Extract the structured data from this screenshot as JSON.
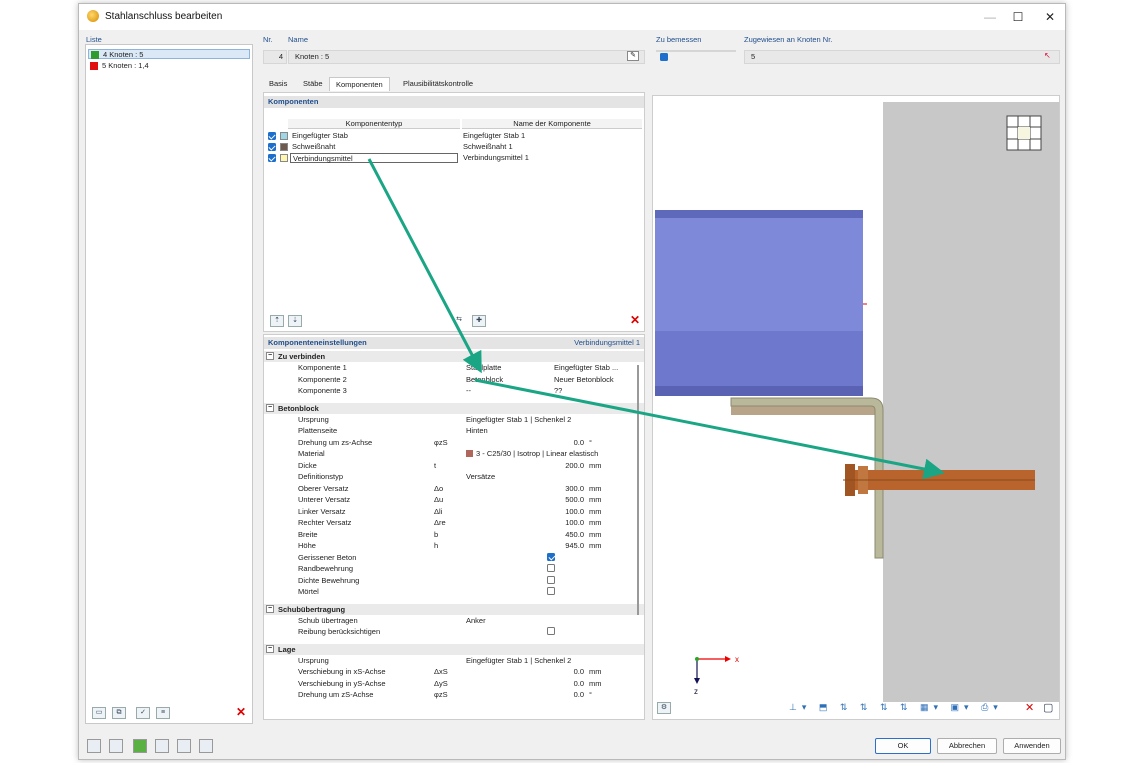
{
  "window": {
    "title": "Stahlanschluss bearbeiten"
  },
  "list": {
    "label": "Liste",
    "items": [
      {
        "label": "4 Knoten : 5",
        "color": "#2e9b2e",
        "selected": true
      },
      {
        "label": "5 Knoten : 1,4",
        "color": "#e01010",
        "selected": false
      }
    ]
  },
  "header": {
    "nr_label": "Nr.",
    "nr_value": "4",
    "name_label": "Name",
    "name_value": "Knoten : 5",
    "zu_bemessen_label": "Zu bemessen",
    "zugewiesen_label": "Zugewiesen an Knoten Nr.",
    "zugewiesen_value": "5"
  },
  "tabs": [
    {
      "label": "Basis"
    },
    {
      "label": "Stäbe"
    },
    {
      "label": "Komponenten",
      "active": true
    },
    {
      "label": "Plausibilitätskontrolle"
    }
  ],
  "components": {
    "title": "Komponenten",
    "col_type": "Komponententyp",
    "col_name": "Name der Komponente",
    "rows": [
      {
        "type": "Eingefügter Stab",
        "name": "Eingefügter Stab 1",
        "color": "#9fd6e6"
      },
      {
        "type": "Schweißnaht",
        "name": "Schweißnaht 1",
        "color": "#6e5a4e"
      },
      {
        "type": "Verbindungsmittel",
        "name": "Verbindungsmittel 1",
        "color": "#fff6b0"
      }
    ]
  },
  "settings": {
    "title": "Komponenteneinstellungen",
    "current": "Verbindungsmittel 1",
    "groups": [
      {
        "title": "Zu verbinden",
        "rows": [
          {
            "name": "Komponente 1",
            "v": "Stahlplatte",
            "v2": "Eingefügter Stab ..."
          },
          {
            "name": "Komponente 2",
            "v": "Betonblock",
            "v2": "Neuer Betonblock"
          },
          {
            "name": "Komponente 3",
            "v": "--",
            "v2": "??"
          }
        ]
      },
      {
        "title": "Betonblock",
        "rows": [
          {
            "name": "Ursprung",
            "v": "Eingefügter Stab 1 | Schenkel 2"
          },
          {
            "name": "Plattenseite",
            "v": "Hinten"
          },
          {
            "name": "Drehung um zs-Achse",
            "sym": "φzS",
            "num": "0.0",
            "unit": "°"
          },
          {
            "name": "Material",
            "v": "3 - C25/30 | Isotrop | Linear elastisch",
            "swatch": "#b0665a"
          },
          {
            "name": "Dicke",
            "sym": "t",
            "num": "200.0",
            "unit": "mm"
          },
          {
            "name": "Definitionstyp",
            "v": "Versätze"
          },
          {
            "name": "Oberer Versatz",
            "sym": "Δo",
            "num": "300.0",
            "unit": "mm"
          },
          {
            "name": "Unterer Versatz",
            "sym": "Δu",
            "num": "500.0",
            "unit": "mm"
          },
          {
            "name": "Linker Versatz",
            "sym": "Δli",
            "num": "100.0",
            "unit": "mm"
          },
          {
            "name": "Rechter Versatz",
            "sym": "Δre",
            "num": "100.0",
            "unit": "mm"
          },
          {
            "name": "Breite",
            "sym": "b",
            "num": "450.0",
            "unit": "mm"
          },
          {
            "name": "Höhe",
            "sym": "h",
            "num": "945.0",
            "unit": "mm"
          },
          {
            "name": "Gerissener Beton",
            "check": true
          },
          {
            "name": "Randbewehrung",
            "check": false
          },
          {
            "name": "Dichte Bewehrung",
            "check": false
          },
          {
            "name": "Mörtel",
            "check": false
          }
        ]
      },
      {
        "title": "Schubübertragung",
        "rows": [
          {
            "name": "Schub übertragen",
            "v": "Anker"
          },
          {
            "name": "Reibung berücksichtigen",
            "check": false
          }
        ]
      },
      {
        "title": "Lage",
        "rows": [
          {
            "name": "Ursprung",
            "v": "Eingefügter Stab 1 | Schenkel 2"
          },
          {
            "name": "Verschiebung in xS-Achse",
            "sym": "ΔxS",
            "num": "0.0",
            "unit": "mm"
          },
          {
            "name": "Verschiebung in yS-Achse",
            "sym": "ΔyS",
            "num": "0.0",
            "unit": "mm"
          },
          {
            "name": "Drehung um zS-Achse",
            "sym": "φzS",
            "num": "0.0",
            "unit": "°"
          }
        ]
      }
    ]
  },
  "view": {
    "axis_x": "x",
    "axis_z": "z"
  },
  "buttons": {
    "ok": "OK",
    "cancel": "Abbrechen",
    "apply": "Anwenden"
  },
  "colors": {
    "accent": "#1e6fcc",
    "arrow": "#1aa584",
    "beam": "#7c86d6",
    "angle": "#b9b89a",
    "bolt": "#b8642c"
  }
}
